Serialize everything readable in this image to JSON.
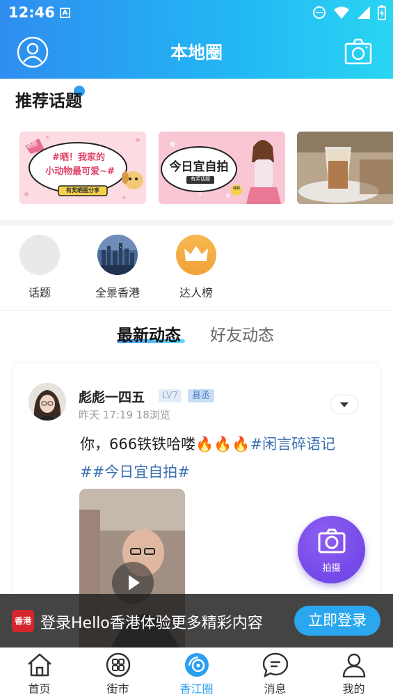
{
  "status_bar": {
    "time": "12:46",
    "notif_letter": "A"
  },
  "header": {
    "title": "本地圈",
    "avatar_icon": "user-circle-icon",
    "camera_icon": "camera-icon"
  },
  "recommended": {
    "title": "推荐话题",
    "cards": [
      {
        "line1": "#晒！我家的",
        "line2": "小动物最可爱~#",
        "tag": "有奖晒图分享",
        "corner": "晒图"
      },
      {
        "title": "今日宜自拍",
        "tag": "有奖话题",
        "badge": "GO"
      },
      {
        "subject": "coffee-photo"
      }
    ]
  },
  "entries": [
    {
      "label": "话题"
    },
    {
      "label": "全景香港"
    },
    {
      "label": "达人榜"
    }
  ],
  "tabs": {
    "active": "最新动态",
    "inactive": "好友动态"
  },
  "post": {
    "author": "彪彪一四五",
    "level": "LV7",
    "title_badge": "县丞",
    "meta": "昨天 17:19  18浏览",
    "text_plain": "你，666铁铁哈喽",
    "emoji": "🔥🔥🔥",
    "tag1": "#闲言碎语记",
    "tag2": "##今日宜自拍#"
  },
  "fab": {
    "label": "拍摄"
  },
  "login_bar": {
    "logo_text": "香港",
    "text": "登录Hello香港体验更多精彩内容",
    "button": "立即登录"
  },
  "nav": [
    {
      "label": "首页",
      "icon": "home-icon"
    },
    {
      "label": "街市",
      "icon": "grid-icon"
    },
    {
      "label": "香江圈",
      "icon": "circle-icon",
      "active": true
    },
    {
      "label": "消息",
      "icon": "message-icon"
    },
    {
      "label": "我的",
      "icon": "profile-icon"
    }
  ],
  "colors": {
    "accent": "#2a9ff0",
    "fab": "#7a4ef0",
    "tag": "#3a6fb0"
  }
}
